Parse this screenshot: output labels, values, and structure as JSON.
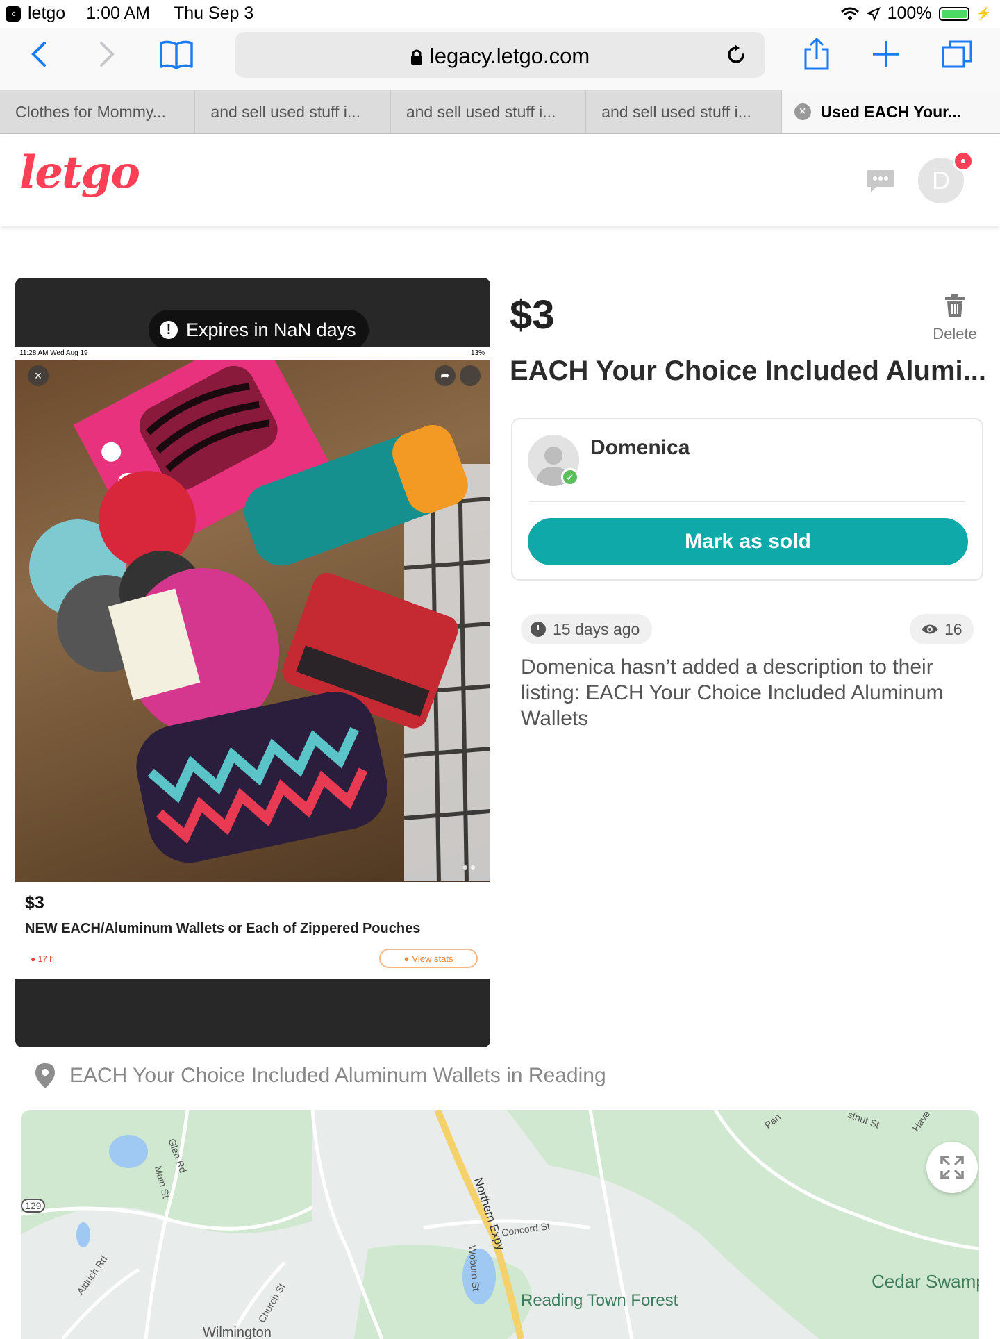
{
  "status_bar": {
    "app": "letgo",
    "time": "1:00 AM",
    "date": "Thu Sep 3",
    "battery": "100%",
    "battery_level": 1.0
  },
  "browser": {
    "url": "legacy.letgo.com",
    "tabs": [
      {
        "label": "Clothes for Mommy..."
      },
      {
        "label": "and sell used stuff i..."
      },
      {
        "label": "and sell used stuff i..."
      },
      {
        "label": "and sell used stuff i..."
      },
      {
        "label": "Used EACH Your..."
      }
    ]
  },
  "site": {
    "logo": "letgo",
    "avatar_initial": "D",
    "brand_color": "#ff3f55"
  },
  "image_card": {
    "expires_label": "Expires in NaN days",
    "screenshot": {
      "status_time": "11:28 AM  Wed Aug 19",
      "status_battery": "13%",
      "price": "$3",
      "title": "NEW EACH/Aluminum Wallets or Each of Zippered Pouches",
      "age": "17 h",
      "stats_button": "View stats"
    }
  },
  "listing": {
    "price": "$3",
    "title": "EACH Your Choice Included Alumi...",
    "delete_label": "Delete",
    "seller_name": "Domenica",
    "mark_sold_label": "Mark as sold",
    "accent_color": "#0fa9a9",
    "posted": "15 days ago",
    "views": "16",
    "description": "Domenica hasn’t added a description to their listing: EACH Your Choice Included Aluminum Wallets"
  },
  "location": {
    "text": "EACH Your Choice Included Aluminum Wallets in Reading",
    "map_labels": {
      "glen_rd": "Glen Rd",
      "main_st": "Main St",
      "route_129": "129",
      "aldrich_rd": "Aldrich Rd",
      "church_st": "Church St",
      "northern_expy": "Northern Expy",
      "woburn_st": "Woburn St",
      "concord_st": "Concord St",
      "forest": "Reading Town Forest",
      "swamp": "Cedar Swamp",
      "wilmington": "Wilmington",
      "pan": "Pan",
      "chestnut_st": "stnut St",
      "haven": "Have",
      "chestnut_right": "tnut"
    }
  }
}
